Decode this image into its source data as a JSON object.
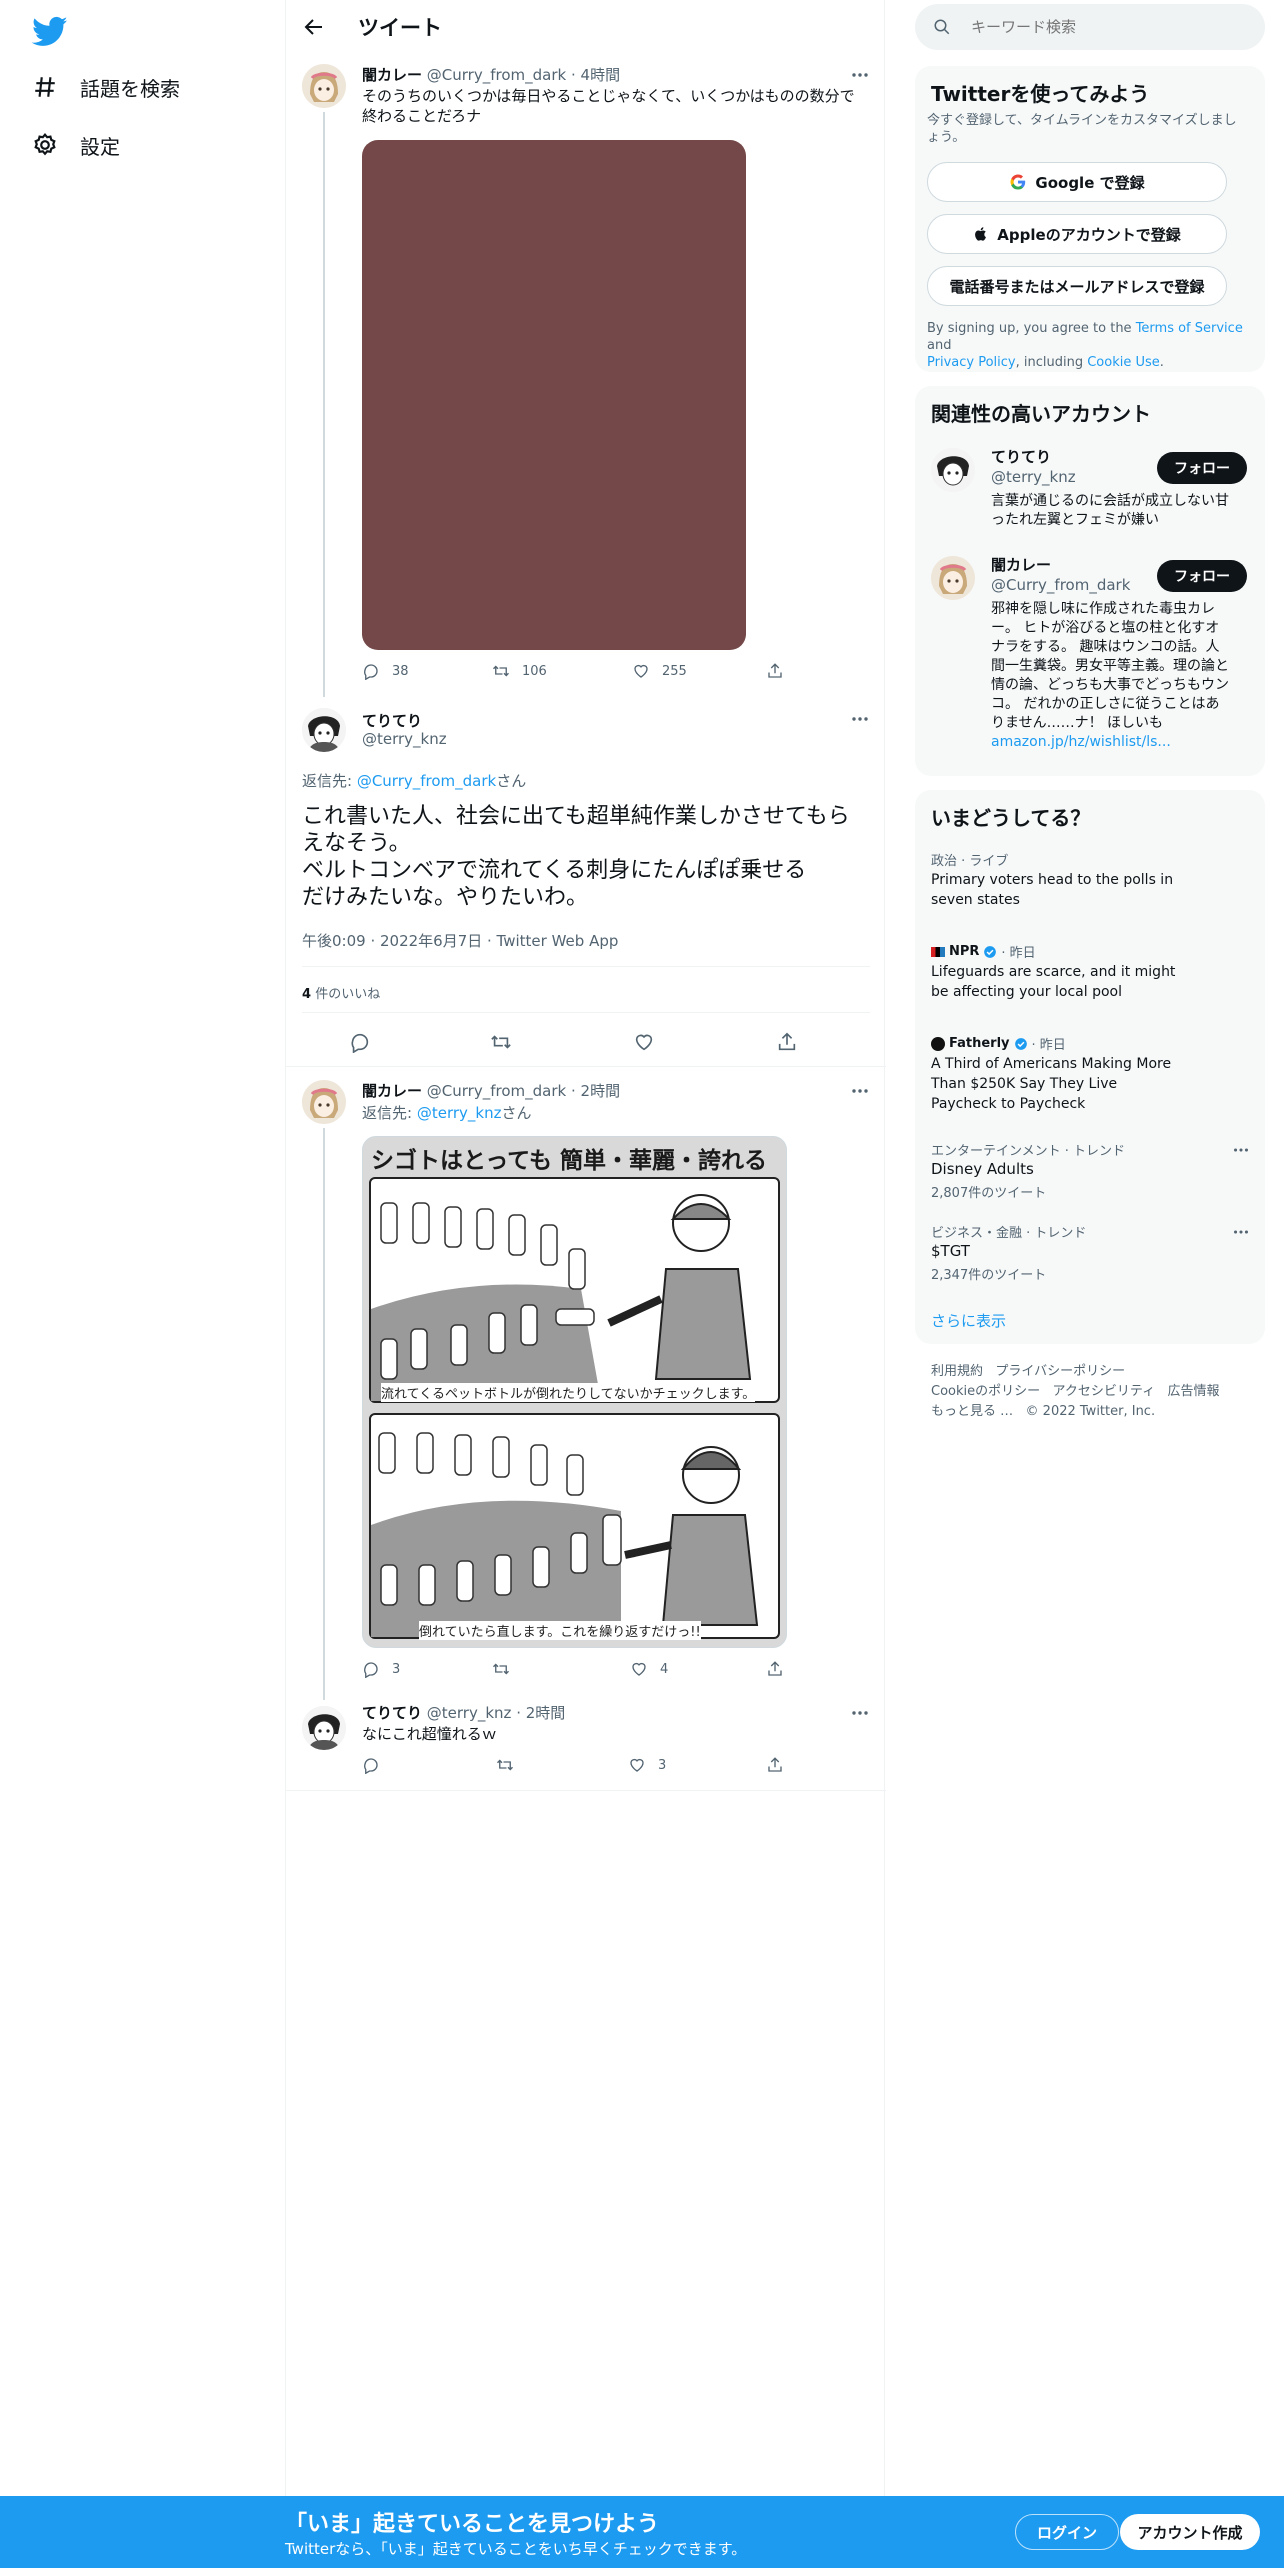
{
  "nav": {
    "explore_label": "話題を検索",
    "settings_label": "設定"
  },
  "header": {
    "title": "ツイート"
  },
  "tweets": {
    "t1": {
      "name": "闇カレー",
      "handle": "@Curry_from_dark",
      "time": "4時間",
      "text_line1": "そのうちのいくつかは毎日やることじゃなくて、いくつかはものの数分で",
      "text_line2": "終わることだろナ",
      "replies": "38",
      "retweets": "106",
      "likes": "255",
      "image_color": "#744848"
    },
    "main": {
      "name": "てりてり",
      "handle": "@terry_knz",
      "reply_to_prefix": "返信先: ",
      "reply_to_handle": "@Curry_from_dark",
      "reply_to_suffix": "さん",
      "text_line1": "これ書いた人、社会に出ても超単純作業しかさせてもら",
      "text_line2": "えなそう。",
      "text_line3": "ベルトコンベアで流れてくる刺身にたんぽぽ乗せる",
      "text_line4": "だけみたいな。やりたいわ。",
      "meta": "午後0:09 · 2022年6月7日 · Twitter Web App",
      "likes_count": "4",
      "likes_label": "件のいいね"
    },
    "t3": {
      "name": "闇カレー",
      "handle": "@Curry_from_dark",
      "time": "2時間",
      "reply_prefix": "返信先: ",
      "reply_handle": "@terry_knz",
      "reply_suffix": "さん",
      "manga_title": "シゴトはとっても 簡単・華麗・誇れる",
      "manga_caption1": "流れてくるペットボトルが倒れたりしてないかチェックします。",
      "manga_caption2": "倒れていたら直します。これを繰り返すだけっ!!",
      "replies": "3",
      "likes": "4"
    },
    "t4": {
      "name": "てりてり",
      "handle": "@terry_knz",
      "time": "2時間",
      "text": "なにこれ超憧れるｗ",
      "likes": "3"
    }
  },
  "right": {
    "search_placeholder": "キーワード検索",
    "signup": {
      "title": "Twitterを使ってみよう",
      "subtitle_line1": "今すぐ登録して、タイムラインをカスタマイズしまし",
      "subtitle_line2": "ょう。",
      "google": "Google で登録",
      "apple": "Appleのアカウントで登録",
      "phone": "電話番号またはメールアドレスで登録",
      "terms_a": "By signing up, you agree to the ",
      "terms_tos": "Terms of Service",
      "terms_b": " and",
      "terms_pp": "Privacy Policy",
      "terms_c": ", including ",
      "terms_cookie": "Cookie Use",
      "terms_d": "."
    },
    "accounts": {
      "title": "関連性の高いアカウント",
      "follow": "フォロー",
      "a1_name": "てりてり",
      "a1_handle": "@terry_knz",
      "a1_bio_line1": "言葉が通じるのに会話が成立しない甘",
      "a1_bio_line2": "ったれ左翼とフェミが嫌い",
      "a2_name": "闇カレー",
      "a2_handle": "@Curry_from_dark",
      "a2_bio": [
        "邪神を隠し味に作成された毒虫カレ",
        "ー。 ヒトが浴びると塩の柱と化すオ",
        "ナラをする。 趣味はウンコの話。人",
        "間一生糞袋。男女平等主義。理の論と",
        "情の論、どっちも大事でどっちもウン",
        "コ。 だれかの正しさに従うことはあ",
        "りません……ナ！ ほしいも"
      ],
      "a2_link": "amazon.jp/hz/wishlist/ls..."
    },
    "trends": {
      "title": "いまどうしてる？",
      "t1_cat": "政治 · ライブ",
      "t1_line1": "Primary voters head to the polls in",
      "t1_line2": "seven states",
      "t2_src": "NPR",
      "t2_time": " · 昨日",
      "t2_line1": "Lifeguards are scarce, and it might",
      "t2_line2": "be affecting your local pool",
      "t3_src": "Fatherly",
      "t3_time": " · 昨日",
      "t3_line1": "A Third of Americans Making More",
      "t3_line2": "Than $250K Say They Live",
      "t3_line3": "Paycheck to Paycheck",
      "t4_cat": "エンターテインメント · トレンド",
      "t4_title": "Disney Adults",
      "t4_count": "2,807件のツイート",
      "t5_cat": "ビジネス・金融 · トレンド",
      "t5_title": "$TGT",
      "t5_count": "2,347件のツイート",
      "show_more": "さらに表示"
    },
    "footer": {
      "l1": "利用規約",
      "l2": "プライバシーポリシー",
      "l3": "Cookieのポリシー",
      "l4": "アクセシビリティ",
      "l5": "広告情報",
      "l6": "もっと見る …",
      "copy": "© 2022 Twitter, Inc."
    }
  },
  "bottom": {
    "headline": "「いま」起きていることを見つけよう",
    "sub": "Twitterなら、「いま」起きていることをいち早くチェックできます。",
    "login": "ログイン",
    "signup": "アカウント作成"
  }
}
